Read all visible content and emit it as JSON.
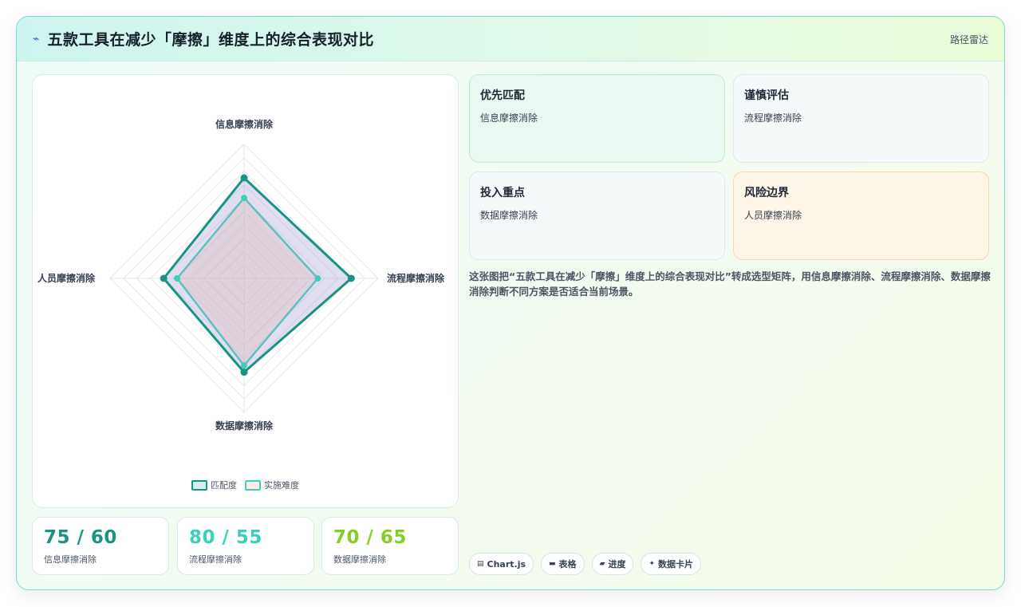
{
  "header": {
    "icon": "zigzag-icon",
    "title": "五款工具在减少「摩擦」维度上的综合表现对比",
    "tag": "路径雷达"
  },
  "chart_data": {
    "type": "radar",
    "axes": [
      "信息摩擦消除",
      "流程摩擦消除",
      "数据摩擦消除",
      "人员摩擦消除"
    ],
    "range": [
      0,
      100
    ],
    "series": [
      {
        "name": "匹配度",
        "values": [
          75,
          80,
          70,
          60
        ],
        "color": "#1a9482"
      },
      {
        "name": "实施难度",
        "values": [
          60,
          55,
          65,
          50
        ],
        "color": "#3cd0b9"
      }
    ],
    "legend_position": "bottom"
  },
  "stats": [
    {
      "value": "75 / 60",
      "label": "信息摩擦消除",
      "color": "#1a9482"
    },
    {
      "value": "80 / 55",
      "label": "流程摩擦消除",
      "color": "#3cd0b9"
    },
    {
      "value": "70 / 65",
      "label": "数据摩擦消除",
      "color": "#86cd24"
    }
  ],
  "cards": [
    {
      "title": "优先匹配",
      "desc": "信息摩擦消除"
    },
    {
      "title": "谨慎评估",
      "desc": "流程摩擦消除"
    },
    {
      "title": "投入重点",
      "desc": "数据摩擦消除"
    },
    {
      "title": "风险边界",
      "desc": "人员摩擦消除"
    }
  ],
  "description": "这张图把“五款工具在减少「摩擦」维度上的综合表现对比”转成选型矩阵，用信息摩擦消除、流程摩擦消除、数据摩擦消除判断不同方案是否适合当前场景。",
  "chips": [
    {
      "icon": "chart-icon",
      "label": "Chart.js"
    },
    {
      "icon": "table-icon",
      "label": "表格"
    },
    {
      "icon": "progress-icon",
      "label": "进度"
    },
    {
      "icon": "sparkle-icon",
      "label": "数据卡片"
    }
  ]
}
